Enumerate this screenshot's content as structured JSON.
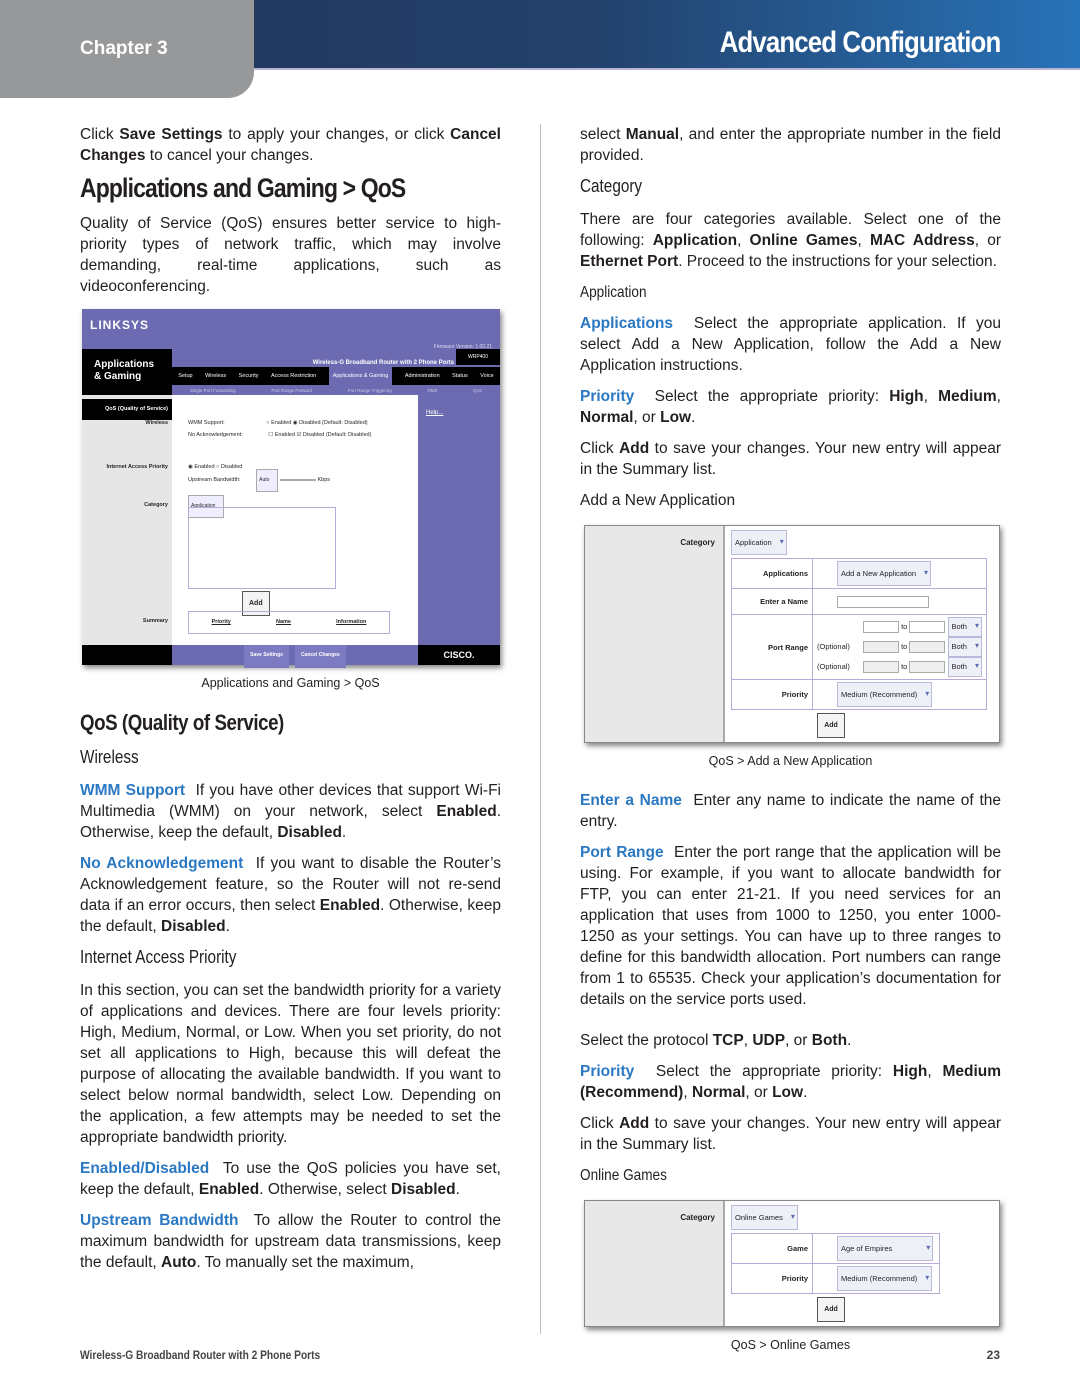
{
  "header": {
    "chapter": "Chapter 3",
    "section": "Advanced Configuration"
  },
  "left": {
    "intro_parts": [
      "Click ",
      "Save Settings",
      " to apply your changes, or click ",
      "Cancel Changes",
      " to cancel your changes."
    ],
    "title": "Applications and Gaming > QoS",
    "qos_intro": "Quality of Service (QoS) ensures better service to high-priority types of network traffic, which may involve demanding, real-time applications, such as videoconferencing.",
    "figure": {
      "logo": "LINKSYS",
      "firmware": "Firmware Version: 1.00.21",
      "section_label_1": "Applications",
      "section_label_2": "& Gaming",
      "product": "Wireless-G Broadband Router with 2 Phone Ports",
      "model": "WRP400",
      "tabs": [
        "Setup",
        "Wireless",
        "Security",
        "Access Restriction",
        "Applications & Gaming",
        "Administration",
        "Status",
        "Voice"
      ],
      "subtabs": [
        "Single Port Forwarding",
        "Port Range Forward",
        "Port Range Triggering",
        "DMZ",
        "QoS"
      ],
      "labels": [
        "QoS (Quality of Service)",
        "Wireless",
        "Internet Access Priority",
        "Category",
        "Summary"
      ],
      "wmm": "WMM Support:",
      "noack": "No Acknowledgement:",
      "enabled": "Enabled",
      "disabled_default": "Disabled (Default: Disabled)",
      "enabled_radio": "Enabled",
      "disabled_radio": "Disabled",
      "upstream": "Upstream Bandwidth:",
      "auto": "Auto",
      "kbps": "Kbps",
      "category_value": "Application",
      "help": "Help...",
      "summary_cols": [
        "Priority",
        "Name",
        "Information"
      ],
      "save": "Save Settings",
      "cancel": "Cancel Changes",
      "cisco": "CISCO."
    },
    "figure_caption": "Applications and Gaming > QoS",
    "qos_heading": "QoS (Quality of Service)",
    "wireless_heading": "Wireless",
    "wmm_term": "WMM Support",
    "wmm_text_1": "If you have other devices that support Wi-Fi Multimedia (WMM) on your network, select ",
    "wmm_enabled": "Enabled",
    "wmm_text_2": ". Otherwise, keep the default, ",
    "wmm_disabled": "Disabled",
    "noack_term": "No Acknowledgement",
    "noack_text_1": "If you want to disable the Router’s Acknowledgement feature, so the Router will not re-send data if an error occurs, then select ",
    "noack_enabled": "Enabled",
    "noack_text_2": ". Otherwise, keep the default, ",
    "noack_disabled": "Disabled",
    "iap_heading": "Internet Access Priority",
    "iap_text": "In this section, you can set the bandwidth priority for a variety of applications and devices. There are four levels priority: High, Medium, Normal, or Low. When you set priority, do not set all applications to High, because this will defeat the purpose of allocating the available bandwidth. If you want to select below normal bandwidth, select Low. Depending on the application, a few attempts may be needed to set the appropriate bandwidth priority.",
    "ed_term": "Enabled/Disabled",
    "ed_text_1": "To use the QoS policies you have set, keep the default, ",
    "ed_enabled": "Enabled",
    "ed_text_2": ". Otherwise, select ",
    "ed_disabled": "Disabled",
    "ub_term": "Upstream Bandwidth",
    "ub_text_1": "To allow the Router to control the maximum bandwidth for upstream data transmissions, keep the default, ",
    "ub_auto": "Auto",
    "ub_text_2": ". To manually set the maximum,"
  },
  "right": {
    "manual_text_1": "select ",
    "manual_bold": "Manual",
    "manual_text_2": ", and enter the appropriate number in the field provided.",
    "category_heading": "Category",
    "category_text_1": "There are four categories available. Select one of the following: ",
    "cat_options": [
      "Application",
      "Online Games",
      "MAC Address",
      "Ethernet Port"
    ],
    "category_text_2": ". Proceed to the instructions for your selection.",
    "application_heading": "Application",
    "apps_term": "Applications",
    "apps_text": "Select the appropriate application. If you select Add a New Application, follow the Add a New Application instructions.",
    "priority_term": "Priority",
    "priority_text": "Select the appropriate priority: ",
    "priority_levels": [
      "High",
      "Medium",
      "Normal",
      "Low"
    ],
    "click_add_1": "Click ",
    "add_bold": "Add",
    "click_add_2": " to save your changes. Your new entry will appear in the Summary list.",
    "add_new_label": "Add a New Application",
    "fig_add": {
      "category_label": "Category",
      "category_value": "Application",
      "applications_label": "Applications",
      "applications_value": "Add a New Application",
      "name_label": "Enter a Name",
      "port_label": "Port Range",
      "optional": "(Optional)",
      "to": "to",
      "proto": "Both",
      "priority_label": "Priority",
      "priority_value": "Medium (Recommend)",
      "add": "Add"
    },
    "fig_add_caption": "QoS > Add a New Application",
    "name_term": "Enter a Name",
    "name_text": "Enter any name to indicate the name of the entry.",
    "port_term": "Port Range",
    "port_text": "Enter the port range that the application will be using. For example, if you want to allocate bandwidth for FTP, you can enter 21-21. If you need services for an application that uses from 1000 to 1250, you enter 1000-1250 as your settings. You can have up to three ranges to define for this bandwidth allocation. Port numbers can range from 1 to 65535. Check your application’s documentation for details on the service ports used.",
    "protocol_text_1": "Select the protocol ",
    "protocols": [
      "TCP",
      "UDP",
      "Both"
    ],
    "priority2_term": "Priority",
    "priority2_text": "Select the appropriate priority: ",
    "priority2_levels": [
      "High",
      "Medium (Recommend)",
      "Normal",
      "Low"
    ],
    "online_heading": "Online Games",
    "fig_games": {
      "category_label": "Category",
      "category_value": "Online Games",
      "game_label": "Game",
      "game_value": "Age of Empires",
      "priority_label": "Priority",
      "priority_value": "Medium (Recommend)",
      "add": "Add"
    },
    "fig_games_caption": "QoS > Online Games"
  },
  "footer": {
    "product": "Wireless-G Broadband Router with 2 Phone Ports",
    "page": "23"
  }
}
